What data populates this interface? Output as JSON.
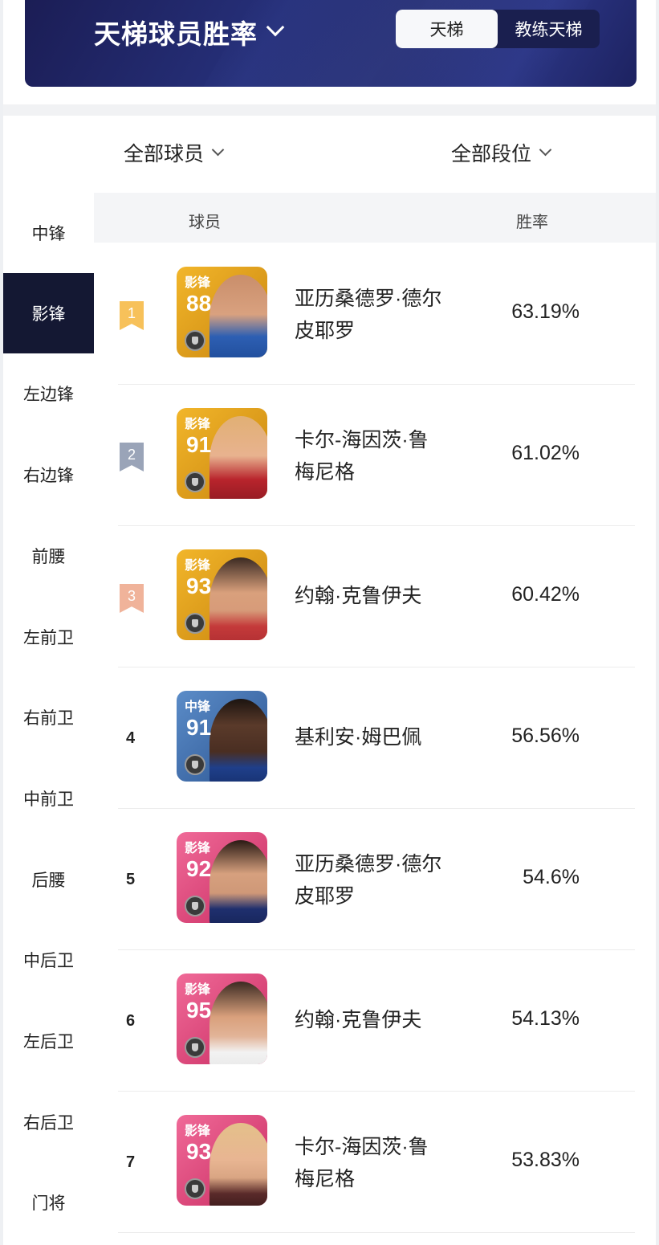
{
  "header": {
    "title": "天梯球员胜率",
    "tabs": [
      {
        "label": "天梯",
        "active": true
      },
      {
        "label": "教练天梯",
        "active": false
      }
    ]
  },
  "filters": {
    "players": "全部球员",
    "tiers": "全部段位"
  },
  "sidebar": {
    "items": [
      {
        "label": "中锋"
      },
      {
        "label": "影锋",
        "active": true
      },
      {
        "label": "左边锋"
      },
      {
        "label": "右边锋"
      },
      {
        "label": "前腰"
      },
      {
        "label": "左前卫"
      },
      {
        "label": "右前卫"
      },
      {
        "label": "中前卫"
      },
      {
        "label": "后腰"
      },
      {
        "label": "中后卫"
      },
      {
        "label": "左后卫"
      },
      {
        "label": "右后卫"
      },
      {
        "label": "门将"
      }
    ]
  },
  "table": {
    "headers": {
      "player": "球员",
      "winrate": "胜率"
    },
    "rows": [
      {
        "rank": "1",
        "position": "影锋",
        "rating": "88",
        "name": "亚历桑德罗·德尔皮耶罗",
        "winrate": "63.19%",
        "card_color": "#e8a21a",
        "ribbon_color": "#f7c15a"
      },
      {
        "rank": "2",
        "position": "影锋",
        "rating": "91",
        "name": "卡尔-海因茨·鲁梅尼格",
        "winrate": "61.02%",
        "card_color": "#e8a21a",
        "ribbon_color": "#9aa4b8"
      },
      {
        "rank": "3",
        "position": "影锋",
        "rating": "93",
        "name": "约翰·克鲁伊夫",
        "winrate": "60.42%",
        "card_color": "#e8a21a",
        "ribbon_color": "#f0b39a"
      },
      {
        "rank": "4",
        "position": "中锋",
        "rating": "91",
        "name": "基利安·姆巴佩",
        "winrate": "56.56%",
        "card_color": "#3f6fae"
      },
      {
        "rank": "5",
        "position": "影锋",
        "rating": "92",
        "name": "亚历桑德罗·德尔皮耶罗",
        "winrate": "54.6%",
        "card_color": "#e2457a"
      },
      {
        "rank": "6",
        "position": "影锋",
        "rating": "95",
        "name": "约翰·克鲁伊夫",
        "winrate": "54.13%",
        "card_color": "#e2457a"
      },
      {
        "rank": "7",
        "position": "影锋",
        "rating": "93",
        "name": "卡尔-海因茨·鲁梅尼格",
        "winrate": "53.83%",
        "card_color": "#e2457a"
      }
    ]
  }
}
